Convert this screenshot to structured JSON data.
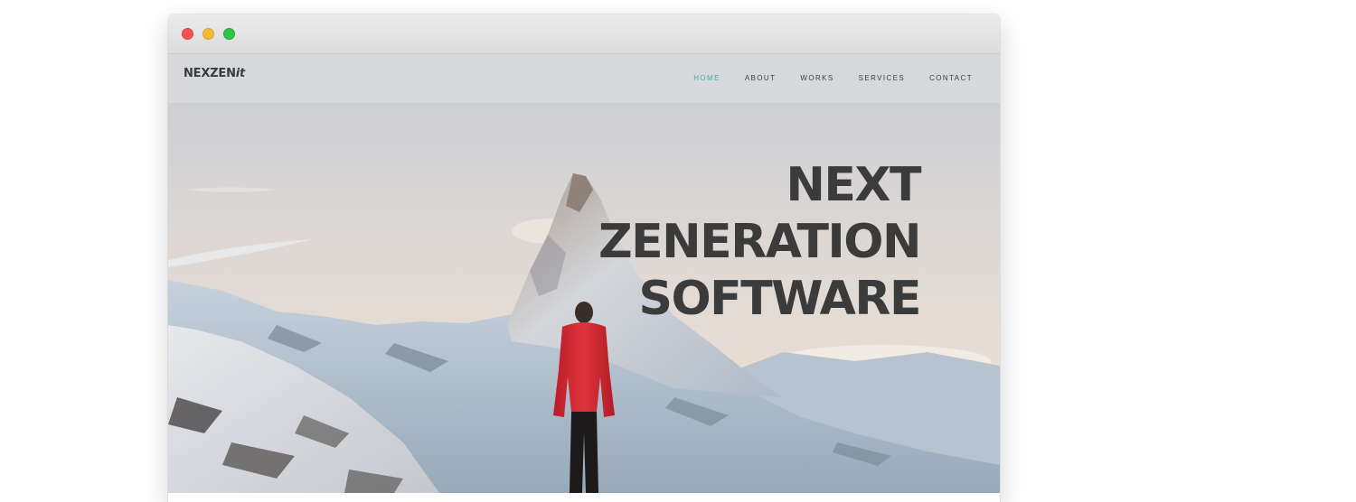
{
  "window": {
    "controls": [
      "close",
      "minimize",
      "maximize"
    ],
    "colors": {
      "close": "#f2544f",
      "minimize": "#f5b93a",
      "maximize": "#2dc647"
    }
  },
  "site": {
    "logo_main": "NEXZEN",
    "logo_suffix": "it",
    "nav": [
      {
        "label": "HOME",
        "active": true
      },
      {
        "label": "ABOUT",
        "active": false
      },
      {
        "label": "WORKS",
        "active": false
      },
      {
        "label": "SERVICES",
        "active": false
      },
      {
        "label": "CONTACT",
        "active": false
      }
    ],
    "accent_color": "#3fb39a"
  },
  "hero": {
    "headline_lines": [
      "NEXT",
      "ZENERATION",
      "SOFTWARE"
    ],
    "image": "mountain-hiker-photo",
    "text_color": "#3b3b3b"
  }
}
